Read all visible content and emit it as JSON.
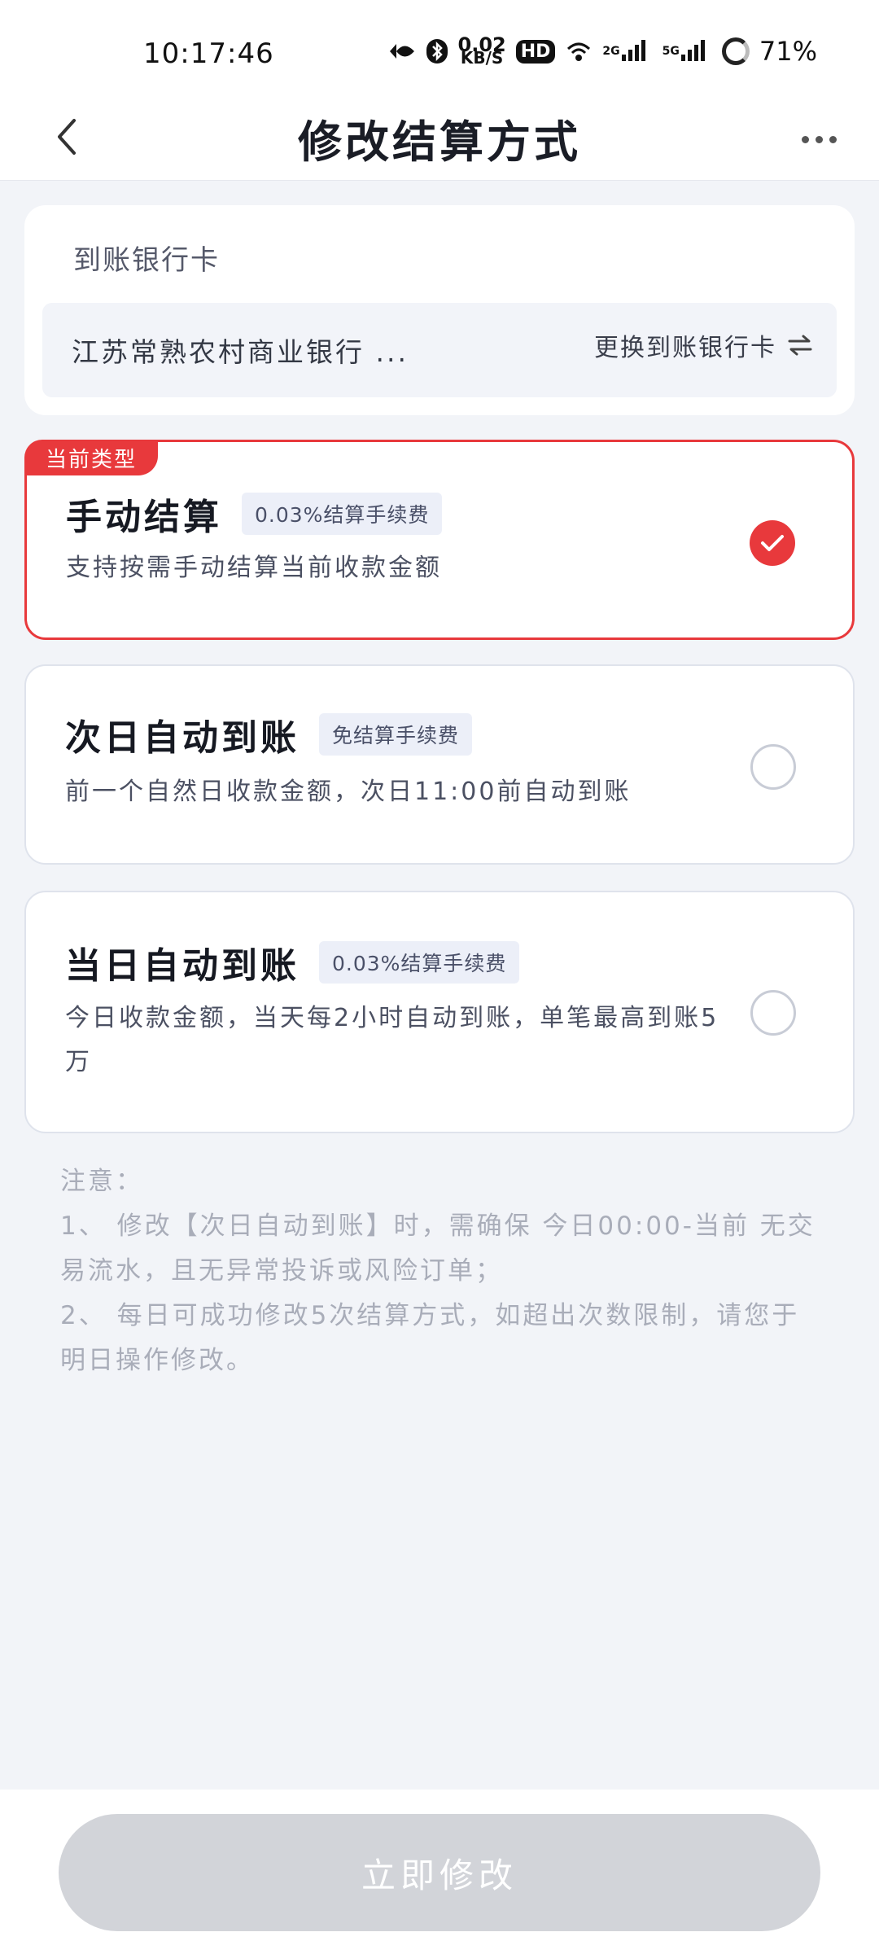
{
  "status_bar": {
    "time": "10:17:46",
    "speed_value": "0.02",
    "speed_unit": "KB/S",
    "hd_label": "HD",
    "net1_label": "2G",
    "net2_label": "5G",
    "battery": "71%"
  },
  "header": {
    "title": "修改结算方式"
  },
  "bank": {
    "title": "到账银行卡",
    "name": "江苏常熟农村商业银行 ...",
    "change_label": "更换到账银行卡"
  },
  "options": [
    {
      "tag": "当前类型",
      "title": "手动结算",
      "fee": "0.03%结算手续费",
      "desc": "支持按需手动结算当前收款金额",
      "selected": true
    },
    {
      "title": "次日自动到账",
      "fee": "免结算手续费",
      "desc": "前一个自然日收款金额，次日11:00前自动到账",
      "selected": false
    },
    {
      "title": "当日自动到账",
      "fee": "0.03%结算手续费",
      "desc": "今日收款金额，当天每2小时自动到账，单笔最高到账5万",
      "selected": false
    }
  ],
  "notes": {
    "title": "注意：",
    "items": [
      "1、 修改【次日自动到账】时，需确保 今日00:00-当前 无交易流水，且无异常投诉或风险订单；",
      "2、 每日可成功修改5次结算方式，如超出次数限制，请您于明日操作修改。"
    ]
  },
  "footer": {
    "submit_label": "立即修改"
  },
  "colors": {
    "accent": "#e8393c",
    "background": "#f2f4f8",
    "button_disabled": "#d2d4d9"
  }
}
